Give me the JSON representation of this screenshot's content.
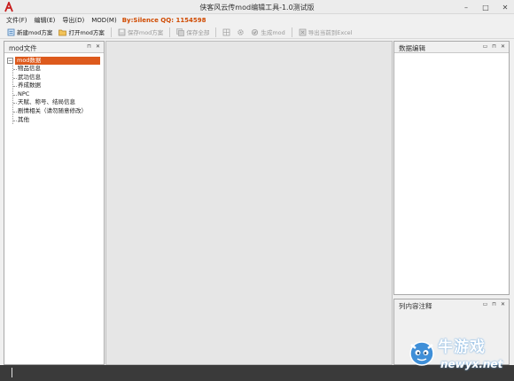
{
  "window": {
    "title": "侠客风云传mod编辑工具-1.0测试版",
    "controls": [
      "–",
      "□",
      "✕"
    ]
  },
  "menu": {
    "items": [
      "文件(F)",
      "编辑(E)",
      "导出(D)",
      "MOD(M)"
    ],
    "credit": "By:Silence  QQ: 1154598"
  },
  "toolbar": {
    "new_mod": "新建mod方案",
    "open_mod": "打开mod方案",
    "save_mod": "保存mod方案",
    "save_all": "保存全部",
    "gen_mod": "生成mod",
    "export_excel": "导出当前到Excel"
  },
  "left_panel": {
    "title": "mod文件",
    "pin": "⊓",
    "close": "✕",
    "tree": {
      "root": "mod数据",
      "toggle": "−",
      "children": [
        "物品信息",
        "武功信息",
        "养成数据",
        "NPC",
        "天赋、称号、结局信息",
        "剧情相关（请勿随意修改）",
        "其他"
      ]
    }
  },
  "right_top_panel": {
    "title": "数据编辑",
    "ctrls": [
      "▭",
      "⊓",
      "✕"
    ]
  },
  "right_bottom_panel": {
    "title": "列内容注释",
    "ctrls": [
      "▭",
      "⊓",
      "✕"
    ]
  },
  "watermark": {
    "text": "牛游戏",
    "url": "newyx.net"
  },
  "colors": {
    "accent": "#dd5a1d",
    "credit": "#d04a00",
    "status_bar": "#3a3a3a"
  }
}
